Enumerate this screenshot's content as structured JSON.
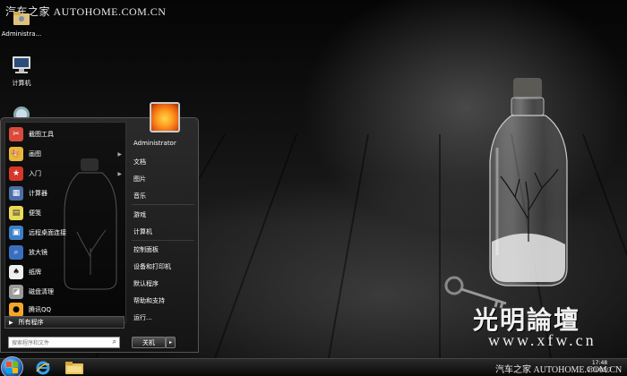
{
  "watermarks": {
    "top_left": "汽车之家 AUTOHOME.COM.CN",
    "brand_big": "光明論壇",
    "url": "www.xfw.cn",
    "taskbar_overlay": "汽车之家  AUTOHOME.COM.CN"
  },
  "desktop_icons": [
    {
      "label": "Administra...",
      "icon": "user-folder-icon"
    },
    {
      "label": "计算机",
      "icon": "computer-icon"
    },
    {
      "label": "",
      "icon": "network-icon"
    }
  ],
  "start_menu": {
    "programs": [
      {
        "label": "截图工具",
        "icon": "scissors-icon",
        "color": "#d94a3a",
        "has_arrow": false
      },
      {
        "label": "画图",
        "icon": "paint-icon",
        "color": "#e8b83a",
        "has_arrow": true
      },
      {
        "label": "入门",
        "icon": "star-icon",
        "color": "#d7372a",
        "has_arrow": true
      },
      {
        "label": "计算器",
        "icon": "calculator-icon",
        "color": "#4a6fa8",
        "has_arrow": false
      },
      {
        "label": "便笺",
        "icon": "sticky-note-icon",
        "color": "#e8d95a",
        "has_arrow": false
      },
      {
        "label": "远程桌面连接",
        "icon": "remote-desktop-icon",
        "color": "#3c7fc8",
        "has_arrow": false
      },
      {
        "label": "放大镜",
        "icon": "magnifier-icon",
        "color": "#3a6fbf",
        "has_arrow": false
      },
      {
        "label": "纸牌",
        "icon": "cards-icon",
        "color": "#efefef",
        "has_arrow": false
      },
      {
        "label": "磁盘清理",
        "icon": "disk-cleanup-icon",
        "color": "#9a9a9a",
        "has_arrow": false
      },
      {
        "label": "腾讯QQ",
        "icon": "qq-icon",
        "color": "#f2a62a",
        "has_arrow": false
      }
    ],
    "all_programs": "所有程序",
    "search_placeholder": "搜索程序和文件",
    "right_items": [
      "Administrator",
      "文档",
      "图片",
      "音乐",
      "游戏",
      "计算机",
      "控制面板",
      "设备和打印机",
      "默认程序",
      "帮助和支持",
      "运行..."
    ],
    "shutdown": "关机",
    "shutdown_arrow": "▸"
  },
  "taskbar": {
    "clock_time": "17:48",
    "clock_date": "2014/5/7"
  }
}
